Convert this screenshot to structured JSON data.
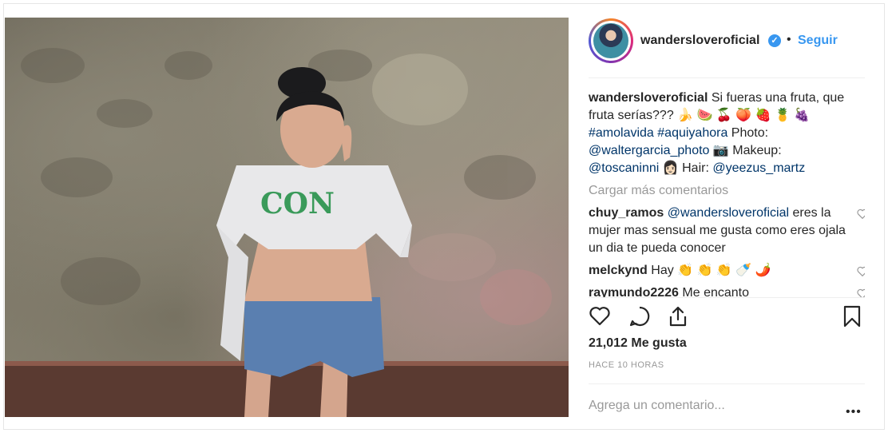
{
  "post": {
    "username": "wanderslover oficial",
    "follow_label": "Seguir",
    "caption_user": "wandersloveroficial",
    "caption_text": "Si fueras una fruta, que fruta serías??? 🍌 🍉 🍒 🍑 🍓 🍍 🍇",
    "caption_tags": "#amolavida #aquiyahora",
    "caption_photo_label": "Photo:",
    "caption_photo_credit": "@waltergarcia_photo",
    "caption_camera": "📷",
    "caption_makeup_label": "Makeup:",
    "caption_makeup_credit": "@toscaninni",
    "caption_person": "👩🏻",
    "caption_hair_label": "Hair:",
    "caption_hair_credit": "@yeezus_martz",
    "load_more": "Cargar más comentarios",
    "comments": [
      {
        "user": "chuy_ramos",
        "mention": "@wandersloveroficial",
        "text": "eres la mujer mas sensual me gusta como eres ojala un dia te pueda conocer"
      },
      {
        "user": "melckynd",
        "text": "Hay 👏 👏 👏 🍼 🌶️"
      },
      {
        "user": "raymundo2226",
        "text": "Me encanto"
      }
    ],
    "likes": "21,012 Me gusta",
    "time": "HACE 10 HORAS",
    "add_comment_placeholder": "Agrega un comentario...",
    "more_label": "•••"
  },
  "icons": [
    "heart-icon",
    "comment-icon",
    "share-icon",
    "bookmark-icon",
    "verified-icon",
    "more-icon"
  ],
  "colors": {
    "link": "#3897f0",
    "mention": "#003569",
    "muted": "#999999",
    "text": "#262626"
  }
}
